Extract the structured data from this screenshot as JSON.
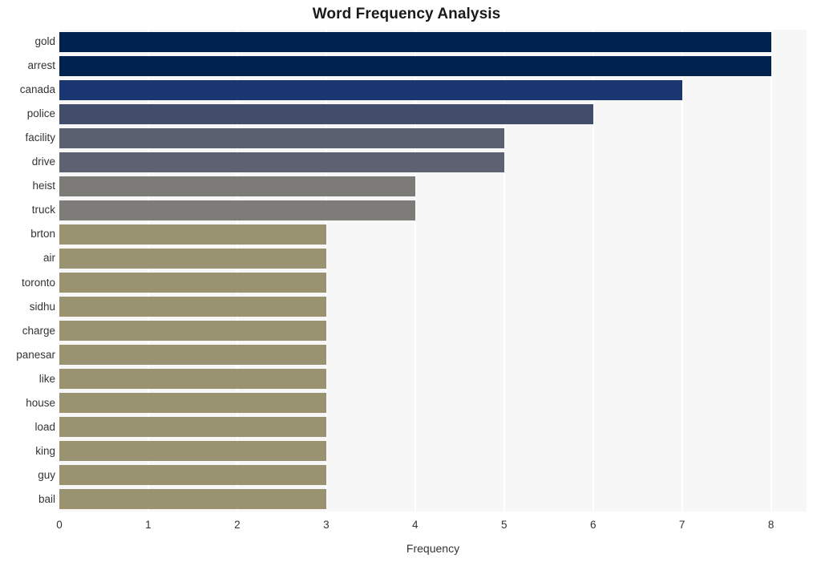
{
  "chart_data": {
    "type": "bar",
    "orientation": "horizontal",
    "title": "Word Frequency Analysis",
    "xlabel": "Frequency",
    "ylabel": "",
    "xlim": [
      0,
      8.4
    ],
    "xticks": [
      "0",
      "1",
      "2",
      "3",
      "4",
      "5",
      "6",
      "7",
      "8"
    ],
    "xtick_values": [
      0,
      1,
      2,
      3,
      4,
      5,
      6,
      7,
      8
    ],
    "grid": "vertical-white-on-light-gray",
    "legend": "none",
    "categories": [
      "gold",
      "arrest",
      "canada",
      "police",
      "facility",
      "drive",
      "heist",
      "truck",
      "brton",
      "air",
      "toronto",
      "sidhu",
      "charge",
      "panesar",
      "like",
      "house",
      "load",
      "king",
      "guy",
      "bail"
    ],
    "values": [
      8,
      8,
      7,
      6,
      5,
      5,
      4,
      4,
      3,
      3,
      3,
      3,
      3,
      3,
      3,
      3,
      3,
      3,
      3,
      3
    ],
    "bar_colors": [
      "#00224e",
      "#00224e",
      "#1b3670",
      "#414d6b",
      "#5a6070",
      "#5d6171",
      "#7c7b78",
      "#7d7c78",
      "#9a9372",
      "#9a9372",
      "#9a9372",
      "#9a9372",
      "#9a9372",
      "#9a9372",
      "#9a9372",
      "#9a9372",
      "#9a9372",
      "#9a9372",
      "#9a9372",
      "#9a9372"
    ],
    "colormap": "cividis",
    "plot_background": "#f7f7f7",
    "figure_background": "#ffffff",
    "gridline_color": "#ffffff",
    "text_color": "#333333",
    "title_color": "#1a1a1a"
  }
}
